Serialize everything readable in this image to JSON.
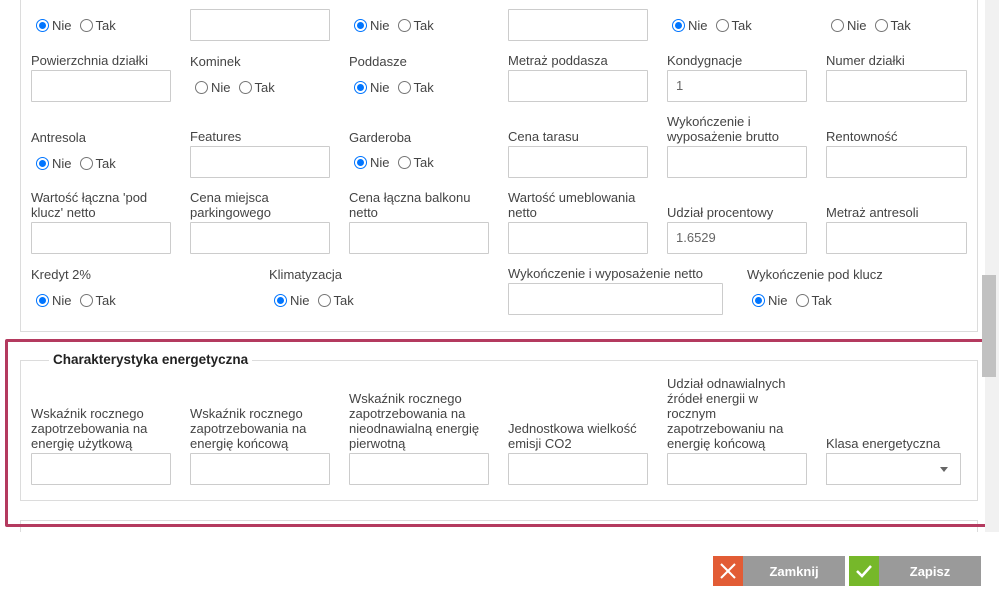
{
  "radio_options": {
    "no": "Nie",
    "yes": "Tak"
  },
  "top_row": {
    "radios": [
      {
        "value": "Nie"
      },
      {
        "value": "Nie"
      },
      {
        "value": "Nie"
      },
      {
        "value": "none"
      }
    ]
  },
  "fields": {
    "powierzchnia_dzialki": {
      "label": "Powierzchnia działki",
      "value": ""
    },
    "kominek": {
      "label": "Kominek",
      "value": "none"
    },
    "poddasze": {
      "label": "Poddasze",
      "value": "Nie"
    },
    "metraz_poddasza": {
      "label": "Metraż poddasza",
      "value": ""
    },
    "kondygnacje": {
      "label": "Kondygnacje",
      "value": "1"
    },
    "numer_dzialki": {
      "label": "Numer działki",
      "value": ""
    },
    "antresola": {
      "label": "Antresola",
      "value": "Nie"
    },
    "features": {
      "label": "Features",
      "value": ""
    },
    "garderoba": {
      "label": "Garderoba",
      "value": "Nie"
    },
    "cena_tarasu": {
      "label": "Cena tarasu",
      "value": ""
    },
    "wykonczenie_brutto": {
      "label": "Wykończenie i wyposażenie brutto",
      "value": ""
    },
    "rentownosc": {
      "label": "Rentowność",
      "value": ""
    },
    "wartosc_pod_klucz": {
      "label": "Wartość łączna 'pod klucz' netto",
      "value": ""
    },
    "cena_parkingowego": {
      "label": "Cena miejsca parkingowego",
      "value": ""
    },
    "cena_balkonu": {
      "label": "Cena łączna balkonu netto",
      "value": ""
    },
    "wartosc_umeblowania": {
      "label": "Wartość umeblowania netto",
      "value": ""
    },
    "udzial_procentowy": {
      "label": "Udział procentowy",
      "value": "1.6529"
    },
    "metraz_antresoli": {
      "label": "Metraż antresoli",
      "value": ""
    },
    "kredyt_2": {
      "label": "Kredyt 2%",
      "value": "Nie"
    },
    "klimatyzacja": {
      "label": "Klimatyzacja",
      "value": "Nie"
    },
    "wykonczenie_netto": {
      "label": "Wykończenie i wyposażenie netto",
      "value": ""
    },
    "wykonczenie_pod_klucz": {
      "label": "Wykończenie pod klucz",
      "value": "Nie"
    }
  },
  "energy": {
    "legend": "Charakterystyka energetyczna",
    "fields": {
      "uzytkowa": {
        "label": "Wskaźnik rocznego zapotrzebowania na energię użytkową",
        "value": ""
      },
      "koncowa": {
        "label": "Wskaźnik rocznego zapotrzebowania na energię końcową",
        "value": ""
      },
      "pierwotna": {
        "label": "Wskaźnik rocznego zapotrzebowania na nieodnawialną energię pierwotną",
        "value": ""
      },
      "co2": {
        "label": "Jednostkowa wielkość emisji CO2",
        "value": ""
      },
      "oze": {
        "label": "Udział odnawialnych źródeł energii w rocznym zapotrzebowaniu na energię końcową",
        "value": ""
      },
      "klasa": {
        "label": "Klasa energetyczna",
        "value": ""
      }
    }
  },
  "footer": {
    "close_label": "Zamknij",
    "save_label": "Zapisz"
  },
  "colors": {
    "highlight": "#b43a5f",
    "radio_checked": "#0075ff",
    "close_icon_bg": "#e25c35",
    "save_icon_bg": "#76b82a",
    "button_bg": "#9a9a9a"
  },
  "icons": {
    "close": "close-icon",
    "save": "check-icon",
    "select_caret": "caret-down-icon"
  }
}
